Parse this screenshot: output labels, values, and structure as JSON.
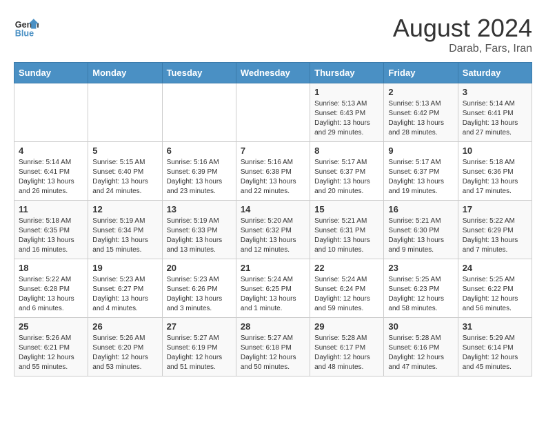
{
  "header": {
    "logo_line1": "General",
    "logo_line2": "Blue",
    "month_year": "August 2024",
    "location": "Darab, Fars, Iran"
  },
  "weekdays": [
    "Sunday",
    "Monday",
    "Tuesday",
    "Wednesday",
    "Thursday",
    "Friday",
    "Saturday"
  ],
  "weeks": [
    [
      {
        "day": "",
        "info": ""
      },
      {
        "day": "",
        "info": ""
      },
      {
        "day": "",
        "info": ""
      },
      {
        "day": "",
        "info": ""
      },
      {
        "day": "1",
        "info": "Sunrise: 5:13 AM\nSunset: 6:43 PM\nDaylight: 13 hours\nand 29 minutes."
      },
      {
        "day": "2",
        "info": "Sunrise: 5:13 AM\nSunset: 6:42 PM\nDaylight: 13 hours\nand 28 minutes."
      },
      {
        "day": "3",
        "info": "Sunrise: 5:14 AM\nSunset: 6:41 PM\nDaylight: 13 hours\nand 27 minutes."
      }
    ],
    [
      {
        "day": "4",
        "info": "Sunrise: 5:14 AM\nSunset: 6:41 PM\nDaylight: 13 hours\nand 26 minutes."
      },
      {
        "day": "5",
        "info": "Sunrise: 5:15 AM\nSunset: 6:40 PM\nDaylight: 13 hours\nand 24 minutes."
      },
      {
        "day": "6",
        "info": "Sunrise: 5:16 AM\nSunset: 6:39 PM\nDaylight: 13 hours\nand 23 minutes."
      },
      {
        "day": "7",
        "info": "Sunrise: 5:16 AM\nSunset: 6:38 PM\nDaylight: 13 hours\nand 22 minutes."
      },
      {
        "day": "8",
        "info": "Sunrise: 5:17 AM\nSunset: 6:37 PM\nDaylight: 13 hours\nand 20 minutes."
      },
      {
        "day": "9",
        "info": "Sunrise: 5:17 AM\nSunset: 6:37 PM\nDaylight: 13 hours\nand 19 minutes."
      },
      {
        "day": "10",
        "info": "Sunrise: 5:18 AM\nSunset: 6:36 PM\nDaylight: 13 hours\nand 17 minutes."
      }
    ],
    [
      {
        "day": "11",
        "info": "Sunrise: 5:18 AM\nSunset: 6:35 PM\nDaylight: 13 hours\nand 16 minutes."
      },
      {
        "day": "12",
        "info": "Sunrise: 5:19 AM\nSunset: 6:34 PM\nDaylight: 13 hours\nand 15 minutes."
      },
      {
        "day": "13",
        "info": "Sunrise: 5:19 AM\nSunset: 6:33 PM\nDaylight: 13 hours\nand 13 minutes."
      },
      {
        "day": "14",
        "info": "Sunrise: 5:20 AM\nSunset: 6:32 PM\nDaylight: 13 hours\nand 12 minutes."
      },
      {
        "day": "15",
        "info": "Sunrise: 5:21 AM\nSunset: 6:31 PM\nDaylight: 13 hours\nand 10 minutes."
      },
      {
        "day": "16",
        "info": "Sunrise: 5:21 AM\nSunset: 6:30 PM\nDaylight: 13 hours\nand 9 minutes."
      },
      {
        "day": "17",
        "info": "Sunrise: 5:22 AM\nSunset: 6:29 PM\nDaylight: 13 hours\nand 7 minutes."
      }
    ],
    [
      {
        "day": "18",
        "info": "Sunrise: 5:22 AM\nSunset: 6:28 PM\nDaylight: 13 hours\nand 6 minutes."
      },
      {
        "day": "19",
        "info": "Sunrise: 5:23 AM\nSunset: 6:27 PM\nDaylight: 13 hours\nand 4 minutes."
      },
      {
        "day": "20",
        "info": "Sunrise: 5:23 AM\nSunset: 6:26 PM\nDaylight: 13 hours\nand 3 minutes."
      },
      {
        "day": "21",
        "info": "Sunrise: 5:24 AM\nSunset: 6:25 PM\nDaylight: 13 hours\nand 1 minute."
      },
      {
        "day": "22",
        "info": "Sunrise: 5:24 AM\nSunset: 6:24 PM\nDaylight: 12 hours\nand 59 minutes."
      },
      {
        "day": "23",
        "info": "Sunrise: 5:25 AM\nSunset: 6:23 PM\nDaylight: 12 hours\nand 58 minutes."
      },
      {
        "day": "24",
        "info": "Sunrise: 5:25 AM\nSunset: 6:22 PM\nDaylight: 12 hours\nand 56 minutes."
      }
    ],
    [
      {
        "day": "25",
        "info": "Sunrise: 5:26 AM\nSunset: 6:21 PM\nDaylight: 12 hours\nand 55 minutes."
      },
      {
        "day": "26",
        "info": "Sunrise: 5:26 AM\nSunset: 6:20 PM\nDaylight: 12 hours\nand 53 minutes."
      },
      {
        "day": "27",
        "info": "Sunrise: 5:27 AM\nSunset: 6:19 PM\nDaylight: 12 hours\nand 51 minutes."
      },
      {
        "day": "28",
        "info": "Sunrise: 5:27 AM\nSunset: 6:18 PM\nDaylight: 12 hours\nand 50 minutes."
      },
      {
        "day": "29",
        "info": "Sunrise: 5:28 AM\nSunset: 6:17 PM\nDaylight: 12 hours\nand 48 minutes."
      },
      {
        "day": "30",
        "info": "Sunrise: 5:28 AM\nSunset: 6:16 PM\nDaylight: 12 hours\nand 47 minutes."
      },
      {
        "day": "31",
        "info": "Sunrise: 5:29 AM\nSunset: 6:14 PM\nDaylight: 12 hours\nand 45 minutes."
      }
    ]
  ]
}
